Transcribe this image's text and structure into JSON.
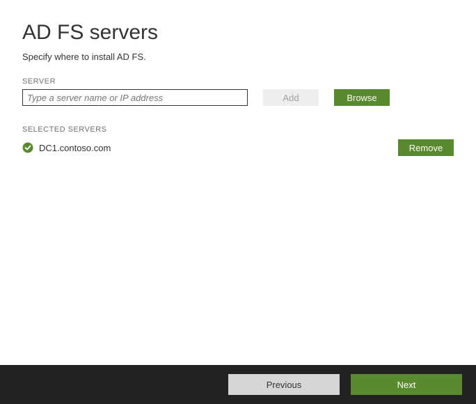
{
  "page": {
    "title": "AD FS servers",
    "subtitle": "Specify where to install AD FS."
  },
  "server_field": {
    "label": "SERVER",
    "placeholder": "Type a server name or IP address",
    "add_label": "Add",
    "browse_label": "Browse"
  },
  "selected": {
    "label": "SELECTED SERVERS",
    "items": [
      {
        "name": "DC1.contoso.com",
        "status": "ok"
      }
    ],
    "remove_label": "Remove"
  },
  "footer": {
    "previous": "Previous",
    "next": "Next"
  },
  "colors": {
    "accent": "#5a8a2e",
    "footer_bg": "#222222"
  }
}
